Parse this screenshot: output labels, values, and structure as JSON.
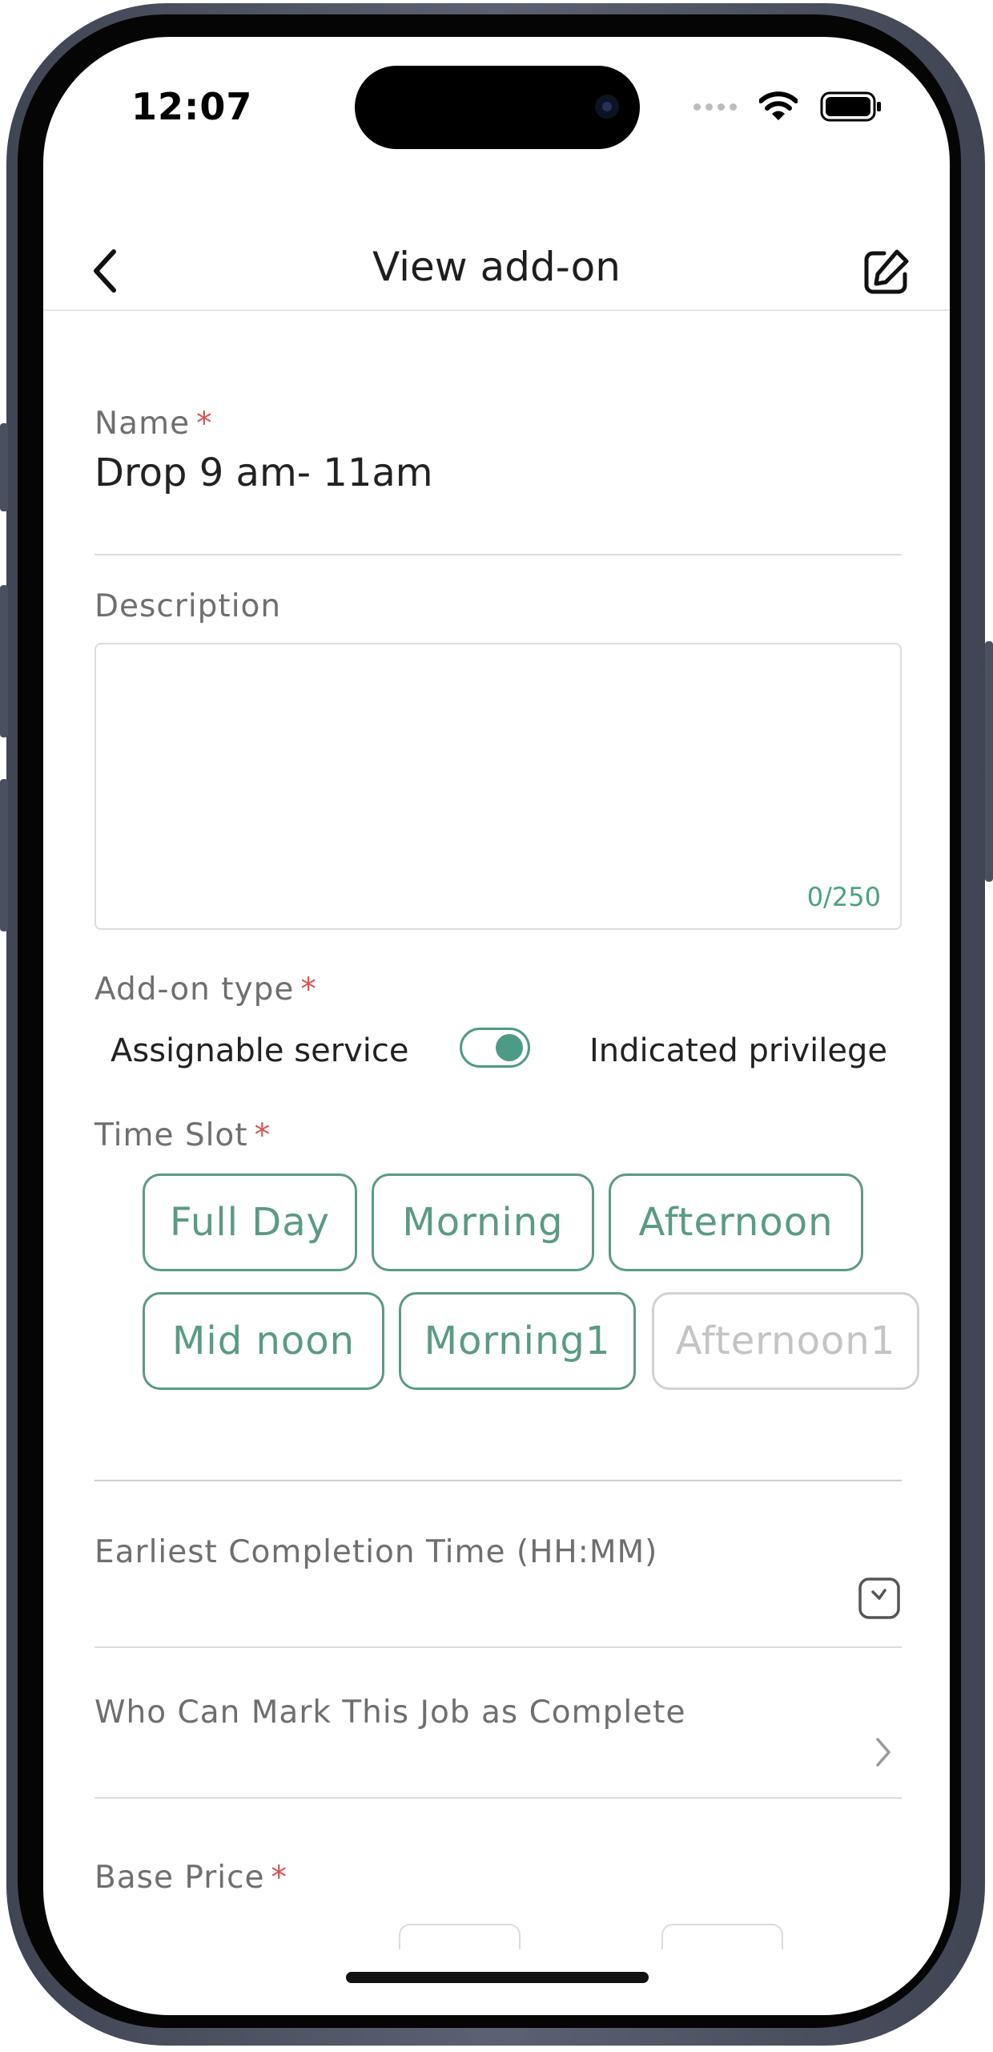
{
  "status_bar": {
    "time": "12:07"
  },
  "nav": {
    "title": "View add-on",
    "back_icon": "chevron-left-icon",
    "edit_icon": "edit-icon"
  },
  "form": {
    "name": {
      "label": "Name",
      "required": "*",
      "value": "Drop 9 am- 11am"
    },
    "description": {
      "label": "Description",
      "value": "",
      "counter": "0/250"
    },
    "addon_type": {
      "label": "Add-on type",
      "required": "*",
      "left_option": "Assignable service",
      "right_option": "Indicated privilege",
      "toggle_state": "right"
    },
    "time_slot": {
      "label": "Time Slot",
      "required": "*",
      "chips": [
        {
          "label": "Full Day",
          "selected": true
        },
        {
          "label": "Morning",
          "selected": true
        },
        {
          "label": "Afternoon",
          "selected": true
        },
        {
          "label": "Mid noon",
          "selected": true
        },
        {
          "label": "Morning1",
          "selected": true
        },
        {
          "label": "Afternoon1",
          "selected": false
        }
      ]
    },
    "earliest_completion": {
      "label": "Earliest Completion Time (HH:MM)",
      "icon": "clock-icon"
    },
    "who_can_mark": {
      "label": "Who Can Mark This Job as Complete",
      "icon": "chevron-right-icon"
    },
    "base_price": {
      "label": "Base Price",
      "required": "*"
    }
  },
  "colors": {
    "accent": "#5a9a86",
    "required": "#d9534f",
    "counter": "#4aa27e",
    "disabled": "#c4c4c4"
  }
}
